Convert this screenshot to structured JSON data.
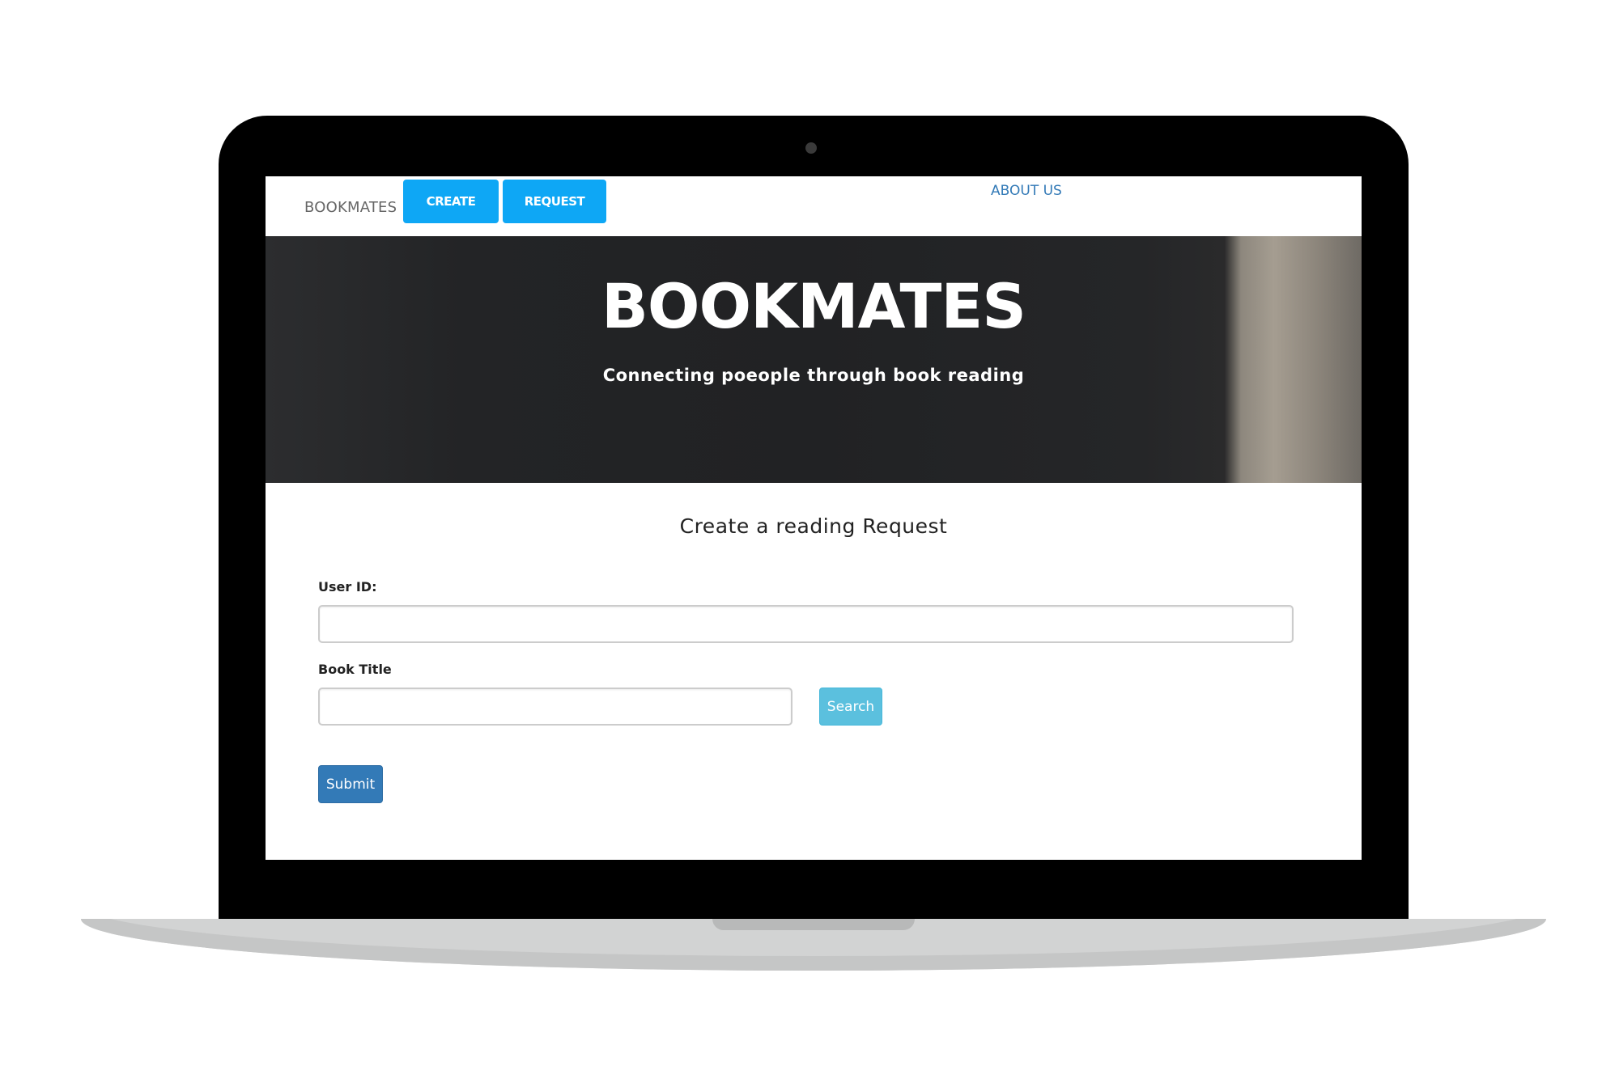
{
  "navbar": {
    "brand": "BOOKMATES",
    "create_label": "CREATE",
    "request_label": "REQUEST",
    "about_label": "ABOUT US"
  },
  "hero": {
    "title": "BOOKMATES",
    "subtitle": "Connecting poeople through book reading"
  },
  "form": {
    "heading": "Create a reading Request",
    "user_id_label": "User ID:",
    "user_id_value": "",
    "book_title_label": "Book Title",
    "book_title_value": "",
    "search_label": "Search",
    "submit_label": "Submit"
  },
  "colors": {
    "nav_button": "#0ea7f5",
    "about_link": "#337ab7",
    "search_button": "#5bc0de",
    "submit_button": "#337ab7",
    "hero_background": "#232426"
  }
}
